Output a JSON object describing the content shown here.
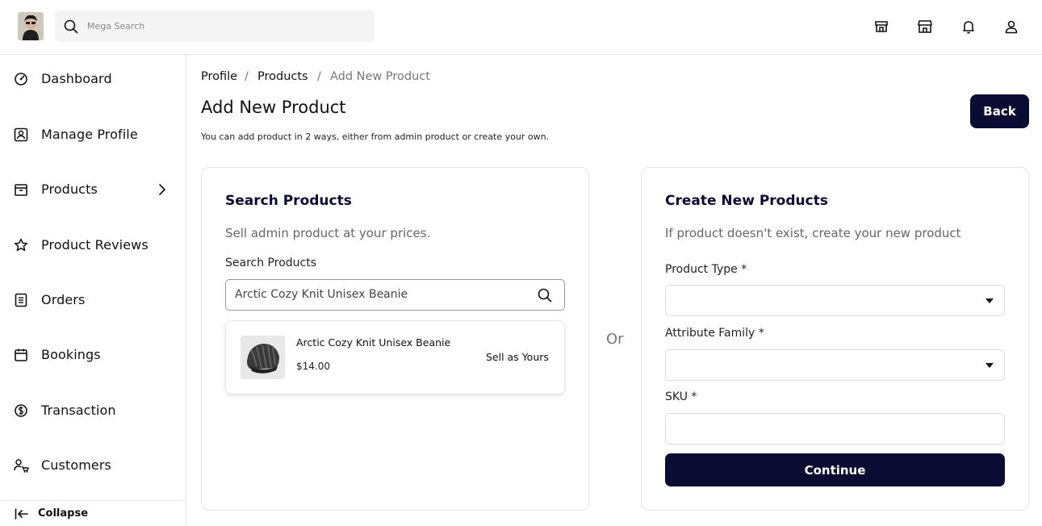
{
  "header": {
    "search_placeholder": "Mega Search",
    "icons": [
      "store-icon",
      "shop-icon",
      "bell-icon",
      "user-icon"
    ]
  },
  "sidebar": {
    "items": [
      {
        "label": "Dashboard",
        "icon": "dashboard-icon"
      },
      {
        "label": "Manage Profile",
        "icon": "profile-icon"
      },
      {
        "label": "Products",
        "icon": "box-icon"
      },
      {
        "label": "Product Reviews",
        "icon": "star-icon"
      },
      {
        "label": "Orders",
        "icon": "orders-icon"
      },
      {
        "label": "Bookings",
        "icon": "calendar-icon"
      },
      {
        "label": "Transaction",
        "icon": "dollar-icon"
      },
      {
        "label": "Customers",
        "icon": "customers-icon"
      }
    ],
    "collapse_label": "Collapse"
  },
  "breadcrumb": {
    "items": [
      "Profile",
      "Products",
      "Add New Product"
    ],
    "separator": "/"
  },
  "page": {
    "title": "Add New Product",
    "subtitle": "You can add product in 2 ways, either from admin product or create your own.",
    "back_label": "Back"
  },
  "search_card": {
    "title": "Search Products",
    "description": "Sell admin product at your prices.",
    "field_label": "Search Products",
    "field_value": "Arctic Cozy Knit Unisex Beanie",
    "result": {
      "name": "Arctic Cozy Knit Unisex Beanie",
      "price": "$14.00",
      "action_label": "Sell as Yours"
    }
  },
  "divider_text": "Or",
  "create_card": {
    "title": "Create New Products",
    "description": "If product doesn't exist, create your new product",
    "product_type_label": "Product Type  *",
    "product_type_value": "",
    "attribute_family_label": "Attribute Family  *",
    "attribute_family_value": "",
    "sku_label": "SKU  *",
    "sku_value": "",
    "continue_label": "Continue"
  },
  "colors": {
    "primary": "#0b0c33",
    "border": "#e4e4e4",
    "muted_text": "#777777"
  }
}
